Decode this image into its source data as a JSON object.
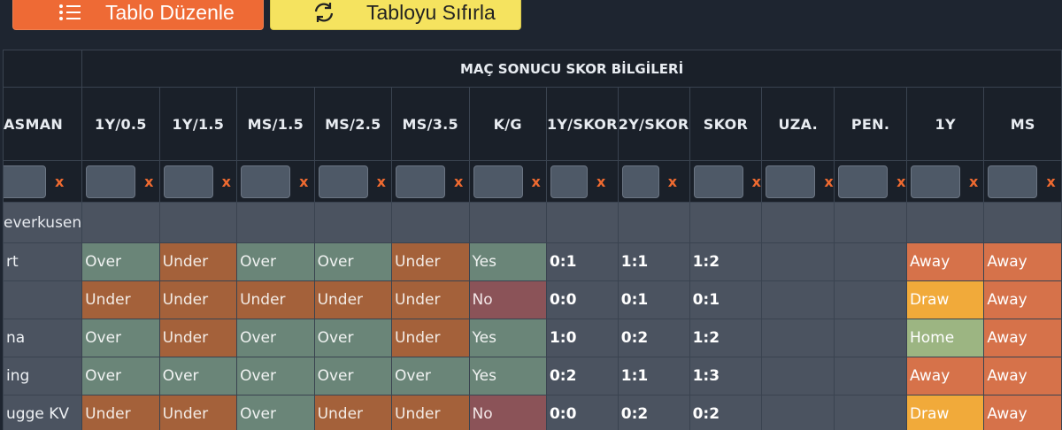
{
  "toolbar": {
    "edit_label": "Tablo Düzenle",
    "reset_label": "Tabloyu Sıfırla"
  },
  "table": {
    "group_title": "MAÇ SONUCU SKOR BİLGİLERİ",
    "first_header": "ASMAN",
    "headers": [
      "1Y/0.5",
      "1Y/1.5",
      "MS/1.5",
      "MS/2.5",
      "MS/3.5",
      "K/G",
      "1Y/SKOR",
      "2Y/SKOR",
      "SKOR",
      "UZA.",
      "PEN.",
      "1Y",
      "MS"
    ],
    "filter_clear": "x",
    "group_row_label": "everkusen",
    "rows": [
      {
        "name": "rt",
        "cells": [
          "Over",
          "Under",
          "Over",
          "Over",
          "Under",
          "Yes",
          "0:1",
          "1:1",
          "1:2",
          "",
          "",
          "Away",
          "Away"
        ]
      },
      {
        "name": "",
        "cells": [
          "Under",
          "Under",
          "Under",
          "Under",
          "Under",
          "No",
          "0:0",
          "0:1",
          "0:1",
          "",
          "",
          "Draw",
          "Away"
        ]
      },
      {
        "name": "na",
        "cells": [
          "Over",
          "Under",
          "Over",
          "Over",
          "Under",
          "Yes",
          "1:0",
          "0:2",
          "1:2",
          "",
          "",
          "Home",
          "Away"
        ]
      },
      {
        "name": "ing",
        "cells": [
          "Over",
          "Over",
          "Over",
          "Over",
          "Over",
          "Yes",
          "0:2",
          "1:1",
          "1:3",
          "",
          "",
          "Away",
          "Away"
        ]
      },
      {
        "name": "ugge KV",
        "cells": [
          "Under",
          "Under",
          "Over",
          "Under",
          "Under",
          "No",
          "0:0",
          "0:2",
          "0:2",
          "",
          "",
          "Draw",
          "Away"
        ]
      }
    ]
  },
  "colors": {
    "over": "#6a8578",
    "under": "#a4613a",
    "no": "#8b5358",
    "away": "#d6724a",
    "draw": "#f1aa3a",
    "home": "#9cb582",
    "edit_button": "#ee6a35",
    "reset_button": "#f5e35f"
  }
}
